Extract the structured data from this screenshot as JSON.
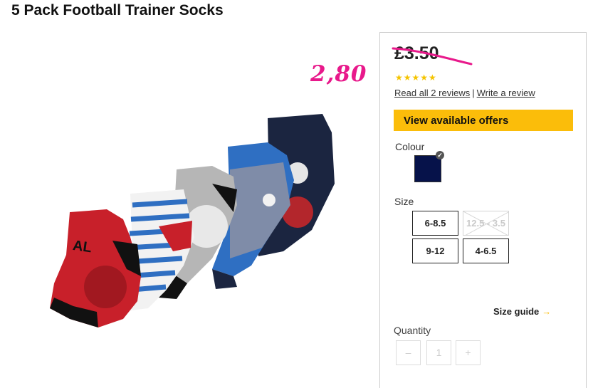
{
  "product": {
    "title": "5 Pack Football Trainer Socks"
  },
  "handwritten_price": "2,80",
  "pricing": {
    "old_price": "£3.50",
    "rating_stars": "★★★★★",
    "rating_value": 5
  },
  "reviews": {
    "read_all": "Read all 2 reviews",
    "separator": "|",
    "write": "Write a review"
  },
  "offers": {
    "label": "View available offers"
  },
  "colour": {
    "label": "Colour",
    "selected": "#06124a"
  },
  "size": {
    "label": "Size",
    "options": [
      {
        "label": "6-8.5",
        "available": true
      },
      {
        "label": "12.5 - 3.5",
        "available": false
      },
      {
        "label": "9-12",
        "available": true
      },
      {
        "label": "4-6.5",
        "available": true
      }
    ]
  },
  "size_guide": {
    "label": "Size guide",
    "arrow": "→"
  },
  "quantity": {
    "label": "Quantity",
    "value": "1",
    "minus": "–",
    "plus": "+"
  },
  "colors": {
    "accent": "#fbbd0a",
    "annotation": "#e8198b",
    "star": "#f5c400"
  }
}
